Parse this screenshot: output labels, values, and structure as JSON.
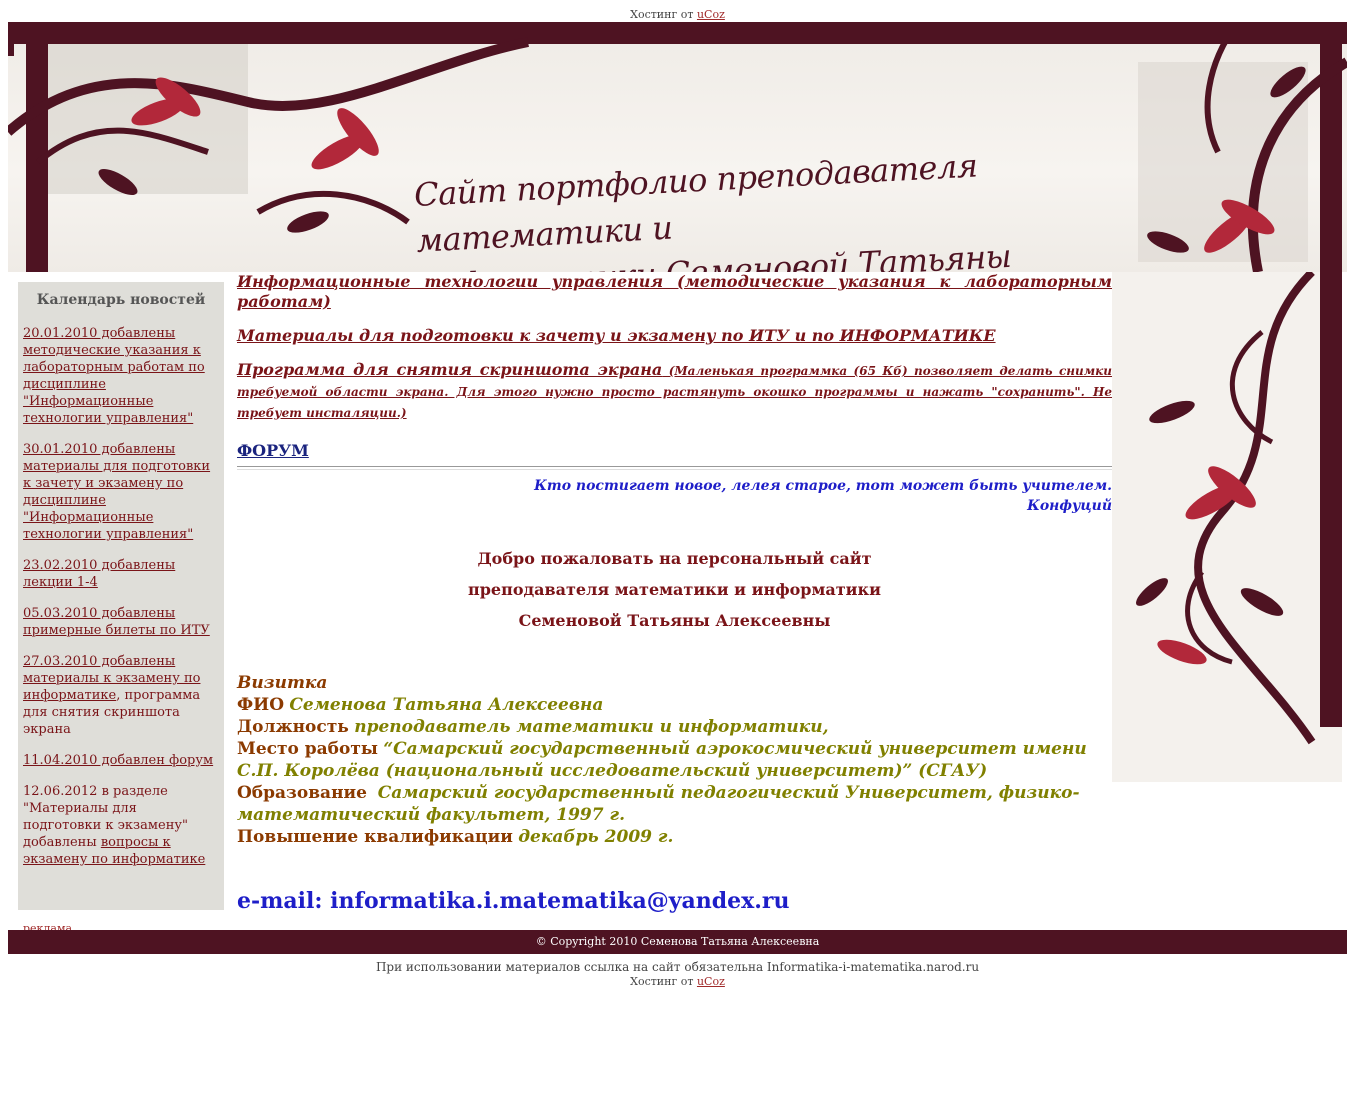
{
  "hosting": {
    "prefix": "Хостинг от",
    "link": "uCoz"
  },
  "header": {
    "title_line1": "Сайт портфолио преподавателя математики и",
    "title_line2": "информатики Семеновой  Татьяны Алексеевны"
  },
  "sidebar": {
    "title": "Календарь новостей",
    "items": [
      {
        "text": "20.01.2010 добавлены методические указания к лабораторным работам по дисциплине \"Информационные технологии управления\""
      },
      {
        "text": "30.01.2010 добавлены материалы для подготовки к зачету и экзамену по дисциплине \"Информационные технологии управления\""
      },
      {
        "text": "23.02.2010 добавлены лекции 1-4"
      },
      {
        "text": "05.03.2010 добавлены примерные билеты по ИТУ"
      },
      {
        "link": "27.03.2010 добавлены материалы к экзамену по информатике",
        "rest": ", программа для снятия скриншота экрана"
      },
      {
        "text": "11.04.2010 добавлен форум"
      },
      {
        "pre": "12.06.2012 в разделе \"Материалы для подготовки к экзамену\" добавлены ",
        "link": "вопросы к экзамену по информатике"
      }
    ],
    "reklama": "реклама"
  },
  "main": {
    "link1": "Информационные технологии управления (методические указания к лабораторным работам)",
    "link2": "Материалы для подготовки к зачету и экзамену по ИТУ и по ИНФОРМАТИКЕ",
    "link3_big": "Программа для снятия скриншота экрана",
    "link3_small": " (Маленькая программка (65 Кб) позволяет делать снимки требуемой области экрана. Для этого нужно просто растянуть окошко программы и нажать \"сохранить\". Не требует инсталяции.)",
    "forum": "ФОРУМ",
    "quote": "Кто постигает новое, лелея старое, тот может быть учителем.",
    "quote_author": "Конфуций",
    "welcome": [
      "Добро пожаловать на персональный сайт",
      "преподавателя математики и информатики",
      "Семеновой Татьяны Алексеевны"
    ],
    "card": {
      "title": "Визитка",
      "fio_label": "ФИО",
      "fio": "Семенова Татьяна Алексеевна",
      "position_label": "Должность",
      "position": "преподаватель математики и информатики,",
      "work_label": "Место работы",
      "work": "“Самарский государственный аэрокосмический университет имени С.П. Королёва (национальный исследовательский университет)” (СГАУ)",
      "edu_label": "Образование",
      "edu": "Самарский государственный педагогический Университет, физико-математический факультет, 1997 г.",
      "qual_label": "Повышение квалификации",
      "qual": "декабрь 2009 г."
    },
    "email": "e-mail: informatika.i.matematika@yandex.ru"
  },
  "footer": {
    "copyright": "© Copyright 2010 Семенова Татьяна Алексеевна",
    "note": "При использовании материалов ссылка на сайт обязательна Informatika-i-matematika.narod.ru"
  },
  "colors": {
    "frame": "#4e1322",
    "link": "#7a1418",
    "accent_blue": "#1e1ec8",
    "olive": "#808000",
    "brown": "#8b3a00"
  }
}
